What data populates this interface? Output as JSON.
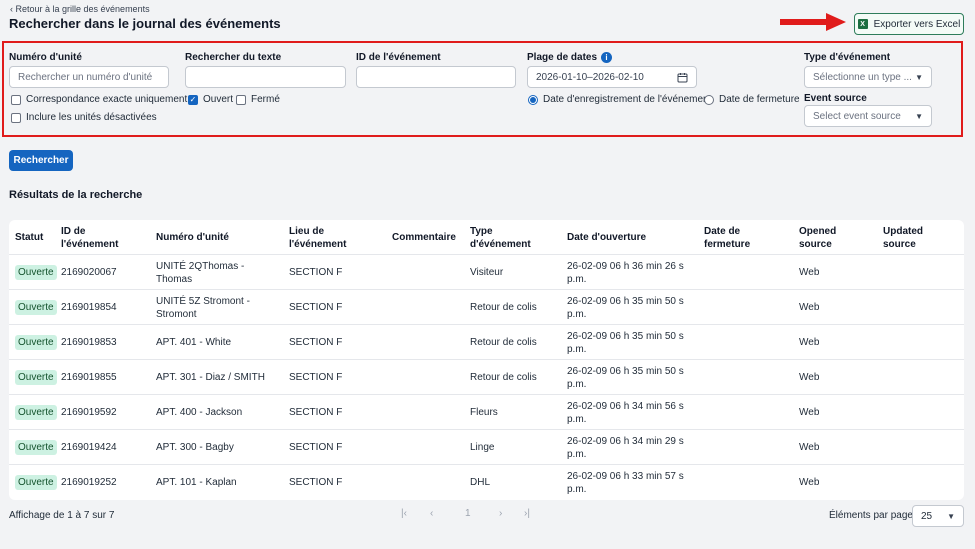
{
  "header": {
    "back_link": "Retour à la grille des événements",
    "title": "Rechercher dans le journal des événements",
    "export_label": "Exporter vers Excel",
    "export_icon": "excel-icon"
  },
  "filters": {
    "unit_label": "Numéro d'unité",
    "unit_placeholder": "Rechercher un numéro d'unité",
    "text_label": "Rechercher du texte",
    "text_value": "",
    "event_id_label": "ID de l'événement",
    "event_id_value": "",
    "date_label": "Plage de dates",
    "date_value": "2026-01-10–2026-02-10",
    "type_label": "Type d'événement",
    "type_placeholder": "Sélectionne un type ...",
    "source_label": "Event source",
    "source_placeholder": "Select event source",
    "exact_match": "Correspondance exacte uniquement",
    "include_disabled": "Inclure les unités désactivées",
    "open_label": "Ouvert",
    "closed_label": "Fermé",
    "radio_recorded": "Date d'enregistrement de l'événement",
    "radio_closing": "Date de fermeture"
  },
  "search_button": "Rechercher",
  "results_title": "Résultats de la recherche",
  "table": {
    "headers": {
      "status": "Statut",
      "event_id_1": "ID de",
      "event_id_2": "l'événement",
      "unit": "Numéro d'unité",
      "location_1": "Lieu de",
      "location_2": "l'événement",
      "comment": "Commentaire",
      "type_1": "Type",
      "type_2": "d'événement",
      "opened": "Date d'ouverture",
      "closed_1": "Date de",
      "closed_2": "fermeture",
      "opened_src_1": "Opened",
      "opened_src_2": "source",
      "updated_src_1": "Updated",
      "updated_src_2": "source"
    },
    "rows": [
      {
        "status": "Ouverte",
        "id": "2169020067",
        "unit": "UNITÉ 2QThomas - Thomas",
        "location": "SECTION F",
        "type": "Visiteur",
        "opened": "26-02-09 06 h 36 min 26 s p.m.",
        "source": "Web"
      },
      {
        "status": "Ouverte",
        "id": "2169019854",
        "unit": "UNITÉ 5Z Stromont - Stromont",
        "location": "SECTION F",
        "type": "Retour de colis",
        "opened": "26-02-09 06 h 35 min 50 s p.m.",
        "source": "Web"
      },
      {
        "status": "Ouverte",
        "id": "2169019853",
        "unit": "APT. 401 - White",
        "location": "SECTION F",
        "type": "Retour de colis",
        "opened": "26-02-09 06 h 35 min 50 s p.m.",
        "source": "Web"
      },
      {
        "status": "Ouverte",
        "id": "2169019855",
        "unit": "APT. 301 - Diaz / SMITH",
        "location": "SECTION F",
        "type": "Retour de colis",
        "opened": "26-02-09 06 h 35 min 50 s p.m.",
        "source": "Web"
      },
      {
        "status": "Ouverte",
        "id": "2169019592",
        "unit": "APT. 400 - Jackson",
        "location": "SECTION F",
        "type": "Fleurs",
        "opened": "26-02-09 06 h 34 min 56 s p.m.",
        "source": "Web"
      },
      {
        "status": "Ouverte",
        "id": "2169019424",
        "unit": "APT. 300 - Bagby",
        "location": "SECTION F",
        "type": "Linge",
        "opened": "26-02-09 06 h 34 min 29 s p.m.",
        "source": "Web"
      },
      {
        "status": "Ouverte",
        "id": "2169019252",
        "unit": "APT. 101 - Kaplan",
        "location": "SECTION F",
        "type": "DHL",
        "opened": "26-02-09 06 h 33 min 57 s p.m.",
        "source": "Web"
      }
    ]
  },
  "footer": {
    "summary": "Affichage de 1 à 7 sur 7",
    "first": "|‹",
    "prev": "‹",
    "page": "1",
    "next": "›",
    "last": "›|",
    "per_page_label": "Éléments par page",
    "per_page_value": "25"
  },
  "colors": {
    "primary": "#1565c0",
    "highlight": "#e01b1b",
    "badge_bg": "#cdf1e2",
    "excel_green": "#1d6f42"
  }
}
